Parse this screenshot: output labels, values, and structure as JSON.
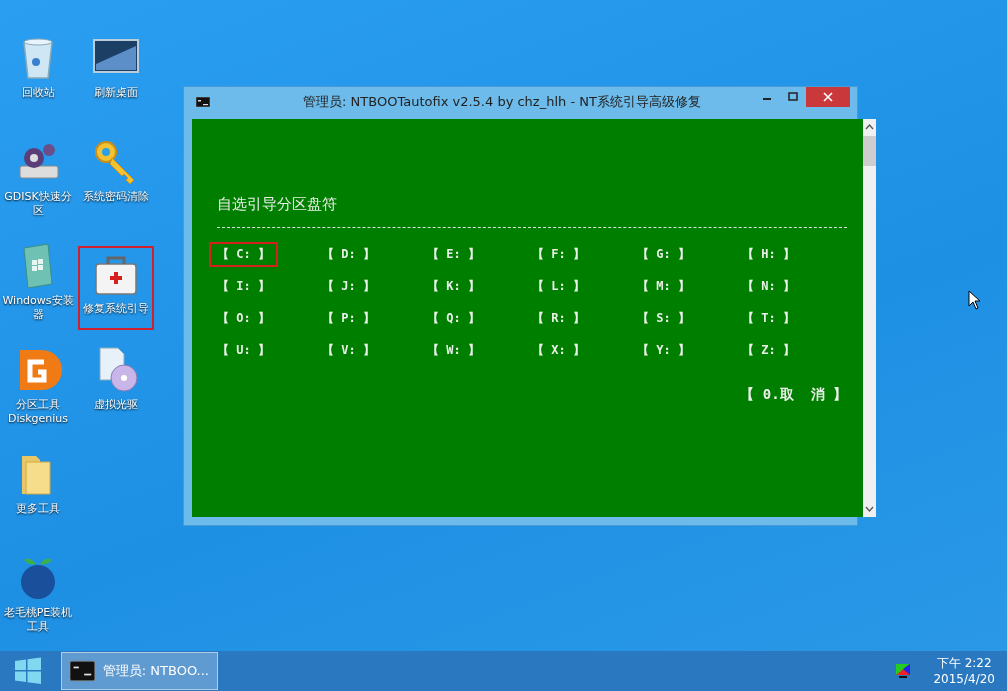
{
  "desktop_icons": [
    {
      "label": "回收站",
      "kind": "recycle-bin",
      "selected": false
    },
    {
      "label": "GDISK快速分区",
      "kind": "gears",
      "selected": false
    },
    {
      "label": "Windows安装器",
      "kind": "installer",
      "selected": false
    },
    {
      "label": "分区工具 Diskgenius",
      "kind": "diskgenius",
      "selected": false
    },
    {
      "label": "更多工具",
      "kind": "folder",
      "selected": false
    },
    {
      "label": "老毛桃PE装机工具",
      "kind": "peach",
      "selected": false
    },
    {
      "label": "刷新桌面",
      "kind": "screen",
      "selected": false
    },
    {
      "label": "系统密码清除",
      "kind": "key",
      "selected": false
    },
    {
      "label": "修复系统引导",
      "kind": "toolbox",
      "selected": true
    },
    {
      "label": "虚拟光驱",
      "kind": "disc",
      "selected": false
    }
  ],
  "window": {
    "title": "管理员:  NTBOOTautofix v2.5.4 by chz_hlh - NT系统引导高级修复",
    "heading": "自选引导分区盘符",
    "drives": [
      {
        "label": "【 C: 】",
        "selected": true
      },
      {
        "label": "【 D: 】",
        "selected": false
      },
      {
        "label": "【 E: 】",
        "selected": false
      },
      {
        "label": "【 F: 】",
        "selected": false
      },
      {
        "label": "【 G: 】",
        "selected": false
      },
      {
        "label": "【 H: 】",
        "selected": false
      },
      {
        "label": "【 I: 】",
        "selected": false
      },
      {
        "label": "【 J: 】",
        "selected": false
      },
      {
        "label": "【 K: 】",
        "selected": false
      },
      {
        "label": "【 L: 】",
        "selected": false
      },
      {
        "label": "【 M: 】",
        "selected": false
      },
      {
        "label": "【 N: 】",
        "selected": false
      },
      {
        "label": "【 O: 】",
        "selected": false
      },
      {
        "label": "【 P: 】",
        "selected": false
      },
      {
        "label": "【 Q: 】",
        "selected": false
      },
      {
        "label": "【 R: 】",
        "selected": false
      },
      {
        "label": "【 S: 】",
        "selected": false
      },
      {
        "label": "【 T: 】",
        "selected": false
      },
      {
        "label": "【 U: 】",
        "selected": false
      },
      {
        "label": "【 V: 】",
        "selected": false
      },
      {
        "label": "【 W: 】",
        "selected": false
      },
      {
        "label": "【 X: 】",
        "selected": false
      },
      {
        "label": "【 Y: 】",
        "selected": false
      },
      {
        "label": "【 Z: 】",
        "selected": false
      }
    ],
    "cancel": "【 0.取  消 】"
  },
  "taskbar": {
    "buttons": [
      {
        "label": "管理员:  NTBOO...",
        "selected": true
      }
    ],
    "clock": {
      "time": "下午 2:22",
      "date": "2015/4/20"
    }
  }
}
